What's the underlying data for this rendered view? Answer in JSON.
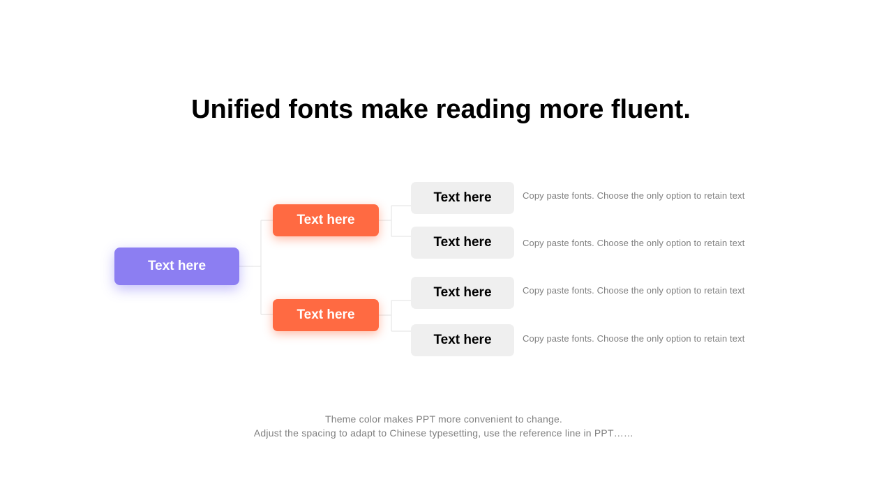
{
  "slide": {
    "title": "Unified fonts make reading more fluent.",
    "colors": {
      "root": "#8C7EF2",
      "branch": "#FF6A42",
      "leaf": "#EFEFEF",
      "connector": "#E6E6E6",
      "desc_text": "#7F7F7F"
    }
  },
  "diagram": {
    "root": {
      "label": "Text here"
    },
    "branches": [
      {
        "label": "Text here",
        "leaves": [
          {
            "label": "Text here",
            "description": "Copy paste fonts. Choose the only option to retain text"
          },
          {
            "label": "Text here",
            "description": "Copy paste fonts. Choose the only option to retain text"
          }
        ]
      },
      {
        "label": "Text here",
        "leaves": [
          {
            "label": "Text here",
            "description": "Copy paste fonts. Choose the only option to retain text"
          },
          {
            "label": "Text here",
            "description": "Copy paste fonts. Choose the only option to retain text"
          }
        ]
      }
    ]
  },
  "footer": {
    "line1": "Theme color makes PPT more convenient to change.",
    "line2": "Adjust the spacing to adapt to Chinese typesetting, use the reference line in PPT……"
  }
}
